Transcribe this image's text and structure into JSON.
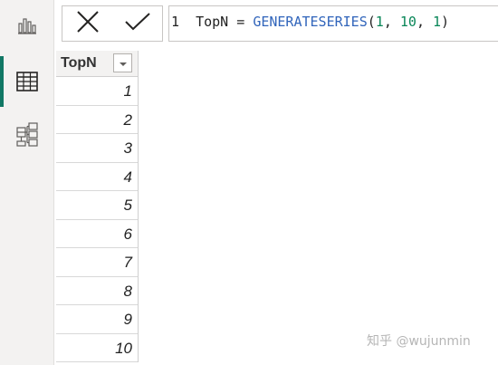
{
  "rail": {
    "items": [
      {
        "name": "report-view",
        "icon": "bar-chart-icon",
        "active": false
      },
      {
        "name": "data-view",
        "icon": "table-grid-icon",
        "active": true
      },
      {
        "name": "model-view",
        "icon": "model-diagram-icon",
        "active": false
      }
    ],
    "accent_color": "#117865"
  },
  "formula_bar": {
    "cancel_icon": "close-icon",
    "commit_icon": "checkmark-icon",
    "line_number": "1",
    "tokens": {
      "name": "TopN",
      "op": " = ",
      "func": "GENERATESERIES",
      "open": "(",
      "arg1": "1",
      "sep1": ", ",
      "arg2": "10",
      "sep2": ", ",
      "arg3": "1",
      "close": ")"
    }
  },
  "table": {
    "column_header": "TopN",
    "filter_icon": "chevron-down-icon",
    "rows": [
      "1",
      "2",
      "3",
      "4",
      "5",
      "6",
      "7",
      "8",
      "9",
      "10"
    ]
  },
  "watermark": {
    "text": "知乎 @wujunmin"
  }
}
